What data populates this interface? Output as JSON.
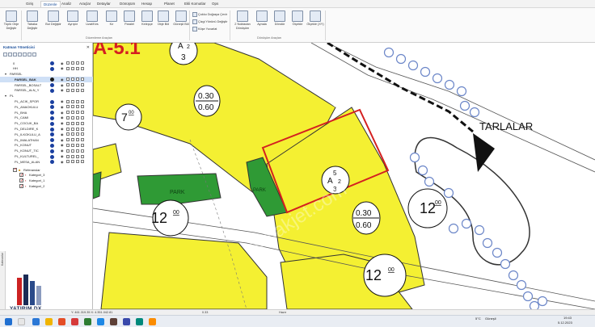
{
  "menu": {
    "tabs": [
      "Giriş",
      "Düzenle",
      "Analiz",
      "Araçlar",
      "Detaylar",
      "Dönüşüm",
      "Hesap",
      "Planet",
      "Ekli Komutlar",
      "Ops"
    ],
    "active_index": 1
  },
  "ribbon": {
    "buttons": [
      {
        "label": "Tüplü Obje Değiştir"
      },
      {
        "label": "Tabaka Değiştir"
      },
      {
        "label": "Bul Değiştir"
      },
      {
        "label": "Ayrıştır"
      },
      {
        "label": "Uzat/Kes"
      },
      {
        "label": "Kır"
      },
      {
        "label": "Paralel"
      },
      {
        "label": "Kelepçe"
      },
      {
        "label": "Obje Böl"
      },
      {
        "label": "Güneşli Böl"
      }
    ],
    "small_buttons": [
      "Çokluı Doğraya Çevir",
      "Çizgi Yönünü Değiştir",
      "Köşe Yuvarlat"
    ],
    "transform_buttons": [
      {
        "label": "2 Noktadan Dönüşüm"
      },
      {
        "label": "Aynala"
      },
      {
        "label": "Döndür"
      },
      {
        "label": "Ölçekle"
      },
      {
        "label": "Ölçekle (XY)"
      }
    ],
    "group_labels": [
      "Düzenleme Araçları",
      "Dönüşüm Araçları"
    ]
  },
  "panel": {
    "title": "Katman Yöneticisi",
    "layers": [
      {
        "name": "0",
        "indent": 8,
        "color": "#1a3fa0"
      },
      {
        "name": "HH",
        "indent": 8,
        "color": "#1a3fa0"
      },
      {
        "name": "PARSEL",
        "indent": 4,
        "color": null,
        "group": true
      },
      {
        "name": "PARSEL_BAK",
        "indent": 10,
        "color": "#1a1a1a",
        "bold": true,
        "selected": true
      },
      {
        "name": "PARSEL_BOSALT",
        "indent": 10,
        "color": "#1a3fa0"
      },
      {
        "name": "PARSEL_ALN_Y",
        "indent": 10,
        "color": "#1a3fa0"
      },
      {
        "name": "PL",
        "indent": 4,
        "color": null,
        "group": true
      },
      {
        "name": "PL_ACIK_SPOR",
        "indent": 10,
        "color": "#1a3fa0"
      },
      {
        "name": "PL_ANAOKULU",
        "indent": 10,
        "color": "#1a3fa0"
      },
      {
        "name": "PL_BHA",
        "indent": 10,
        "color": "#1a3fa0"
      },
      {
        "name": "PL_CAMI",
        "indent": 10,
        "color": "#1a3fa0"
      },
      {
        "name": "PL_COCUK_BA",
        "indent": 10,
        "color": "#1a3fa0"
      },
      {
        "name": "PL_DELDIRE_K",
        "indent": 10,
        "color": "#1a3fa0"
      },
      {
        "name": "PL_ILKOKULU_A",
        "indent": 10,
        "color": "#1a3fa0"
      },
      {
        "name": "PL_IMALATHAN",
        "indent": 10,
        "color": "#1a3fa0"
      },
      {
        "name": "PL_KONUT",
        "indent": 10,
        "color": "#1a3fa0"
      },
      {
        "name": "PL_KONUT_TIC",
        "indent": 10,
        "color": "#1a3fa0"
      },
      {
        "name": "PL_KULTUREL_",
        "indent": 10,
        "color": "#1a3fa0"
      },
      {
        "name": "PL_MESA_ALAN",
        "indent": 10,
        "color": "#1a3fa0"
      }
    ],
    "references": {
      "title": "Referanslar",
      "items": [
        {
          "name": "Kategori_3",
          "checked": true
        },
        {
          "name": "Kategori_1",
          "checked": true
        },
        {
          "name": "Kategori_2",
          "checked": true
        }
      ]
    },
    "side_tabs": [
      "Katmanlar"
    ]
  },
  "map": {
    "labels": {
      "zone_top": "A-5.1",
      "plot_a": {
        "top": "A",
        "sub": "2",
        "bottom": "3"
      },
      "plot_b": {
        "top": "5",
        "mid": "A",
        "sub": "2",
        "bottom": "3"
      },
      "ratio_a": {
        "top": "0.30",
        "bottom": "0.60"
      },
      "ratio_b": {
        "top": "0.30",
        "bottom": "0.60"
      },
      "road_7": "7",
      "road_7_sup": "00",
      "road_12a": "12",
      "road_12a_sup": "00",
      "road_12b": "12",
      "road_12b_sup": "00",
      "road_12c": "12",
      "road_12c_sup": "00",
      "park_1": "PARK",
      "park_2": "PARK",
      "tarlalar": "TARLALAR",
      "watermark": "emlakjet.com"
    },
    "colors": {
      "zone_yellow": "#f4f032",
      "park_green": "#2f9a35",
      "parcel_outline": "#d42020",
      "road_circle": "#6b86c8"
    }
  },
  "statusbar": {
    "coords": "Y: 461.319.35  X: 4.351.042.81",
    "scale": "0.33",
    "mode": "Hazır"
  },
  "logo": {
    "text": "YATIRIM.DX"
  },
  "taskbar": {
    "weather": "5°C",
    "weather_desc": "Güneşli",
    "time": "19:43",
    "date": "5.12.2023"
  }
}
